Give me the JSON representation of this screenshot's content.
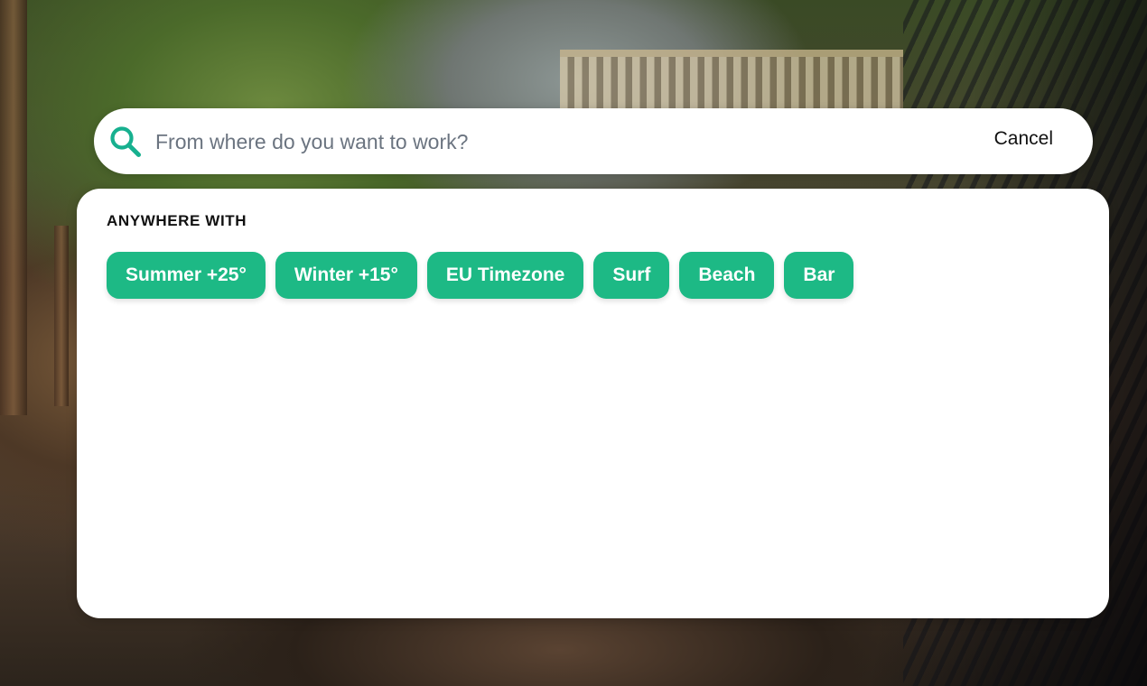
{
  "colors": {
    "accent": "#1db985",
    "search_icon": "#17b08f"
  },
  "search": {
    "icon": "search-icon",
    "placeholder": "From where do you want to work?",
    "value": "",
    "cancel_label": "Cancel"
  },
  "panel": {
    "heading": "ANYWHERE WITH",
    "tags": [
      {
        "label": "Summer +25°"
      },
      {
        "label": "Winter +15°"
      },
      {
        "label": "EU Timezone"
      },
      {
        "label": "Surf"
      },
      {
        "label": "Beach"
      },
      {
        "label": "Bar"
      }
    ]
  }
}
